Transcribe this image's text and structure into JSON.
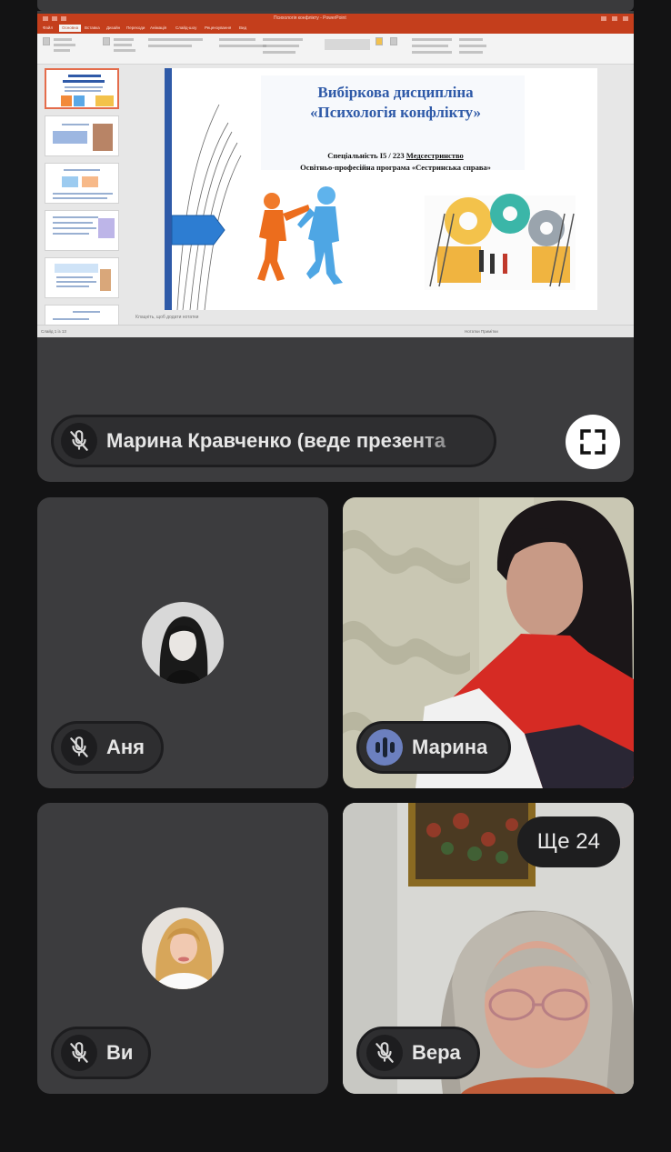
{
  "presenter": {
    "name_label": "Марина Кравченко (веде презента"
  },
  "powerpoint": {
    "window_title": "Психологія конфлікту - PowerPoint",
    "tabs": [
      "Файл",
      "Основна",
      "Вставка",
      "Дизайн",
      "Переходи",
      "Анімація",
      "Слайд-шоу",
      "Рецензування",
      "Вид"
    ],
    "active_tab_index": 1,
    "notes_placeholder": "Клацніть, щоб додати нотатки",
    "status_left": "Слайд 1 із 13",
    "status_right": "Нотатки   Примітки",
    "slide": {
      "title_line1": "Вибіркова дисципліна",
      "title_line2": "«Психологія конфлікту»",
      "specialty_prefix": "Спеціальність I5 / 223 ",
      "specialty_value": "Медсестринство",
      "program": "Освітньо-професійна програма «Сестринська справа»"
    }
  },
  "participants": [
    {
      "name": "Аня",
      "muted": true,
      "type": "avatar"
    },
    {
      "name": "Марина",
      "muted": false,
      "speaking": true,
      "type": "video"
    },
    {
      "name": "Ви",
      "muted": true,
      "type": "avatar"
    },
    {
      "name": "Вера",
      "muted": true,
      "type": "video"
    }
  ],
  "more_participants_label": "Ще 24",
  "colors": {
    "background": "#131314",
    "tile": "#3c3c3e",
    "pill": "#2e2e30",
    "speaking_accent": "#6c80bf",
    "ppt_accent": "#c43e1c"
  },
  "icons": {
    "muted": "mic-off-icon",
    "speaking": "audio-level-icon",
    "fullscreen": "fullscreen-icon"
  }
}
